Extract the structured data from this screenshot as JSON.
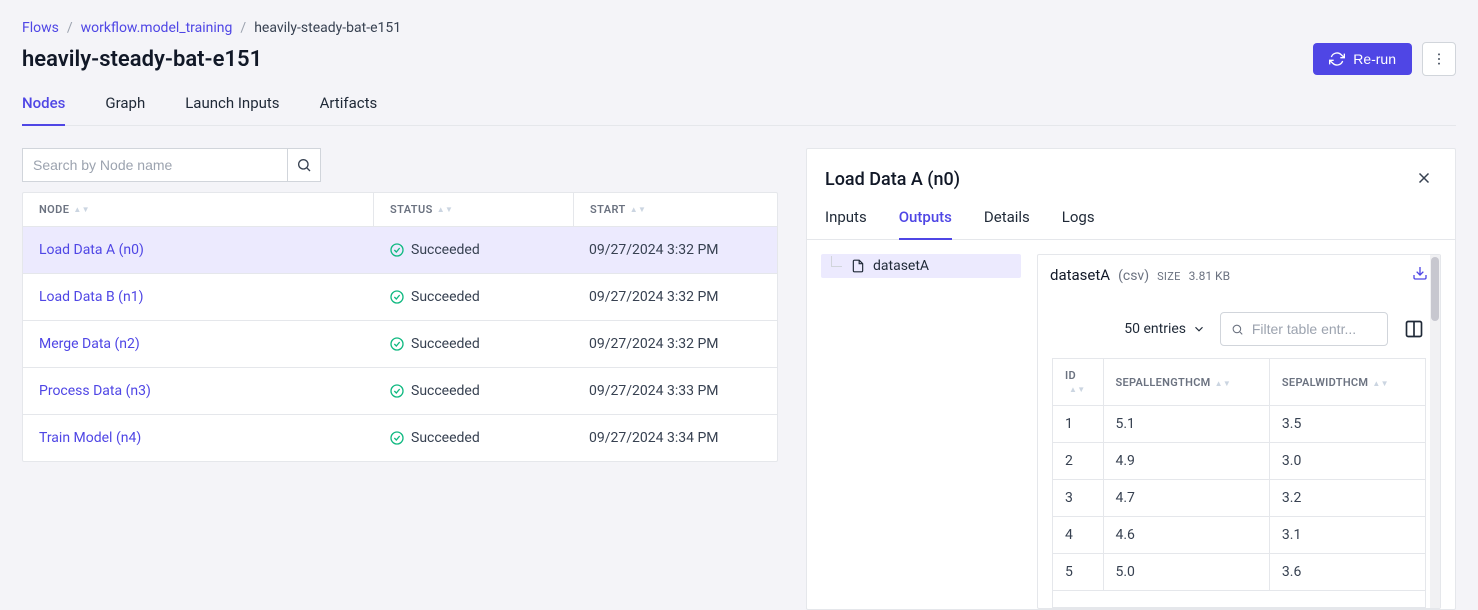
{
  "breadcrumb": {
    "flows": "Flows",
    "workflow": "workflow.model_training",
    "current": "heavily-steady-bat-e151"
  },
  "page_title": "heavily-steady-bat-e151",
  "header": {
    "rerun_label": "Re-run"
  },
  "tabs": [
    "Nodes",
    "Graph",
    "Launch Inputs",
    "Artifacts"
  ],
  "active_tab": 0,
  "search": {
    "placeholder": "Search by Node name"
  },
  "nodes_table": {
    "columns": [
      "NODE",
      "STATUS",
      "START"
    ],
    "rows": [
      {
        "name": "Load Data A (n0)",
        "status": "Succeeded",
        "start": "09/27/2024 3:32 PM",
        "selected": true
      },
      {
        "name": "Load Data B (n1)",
        "status": "Succeeded",
        "start": "09/27/2024 3:32 PM",
        "selected": false
      },
      {
        "name": "Merge Data (n2)",
        "status": "Succeeded",
        "start": "09/27/2024 3:32 PM",
        "selected": false
      },
      {
        "name": "Process Data (n3)",
        "status": "Succeeded",
        "start": "09/27/2024 3:33 PM",
        "selected": false
      },
      {
        "name": "Train Model (n4)",
        "status": "Succeeded",
        "start": "09/27/2024 3:34 PM",
        "selected": false
      }
    ]
  },
  "panel": {
    "title": "Load Data A (n0)",
    "tabs": [
      "Inputs",
      "Outputs",
      "Details",
      "Logs"
    ],
    "active_tab": 1,
    "tree": {
      "item": "datasetA"
    },
    "output": {
      "name": "datasetA",
      "type": "(csv)",
      "size_label": "SIZE",
      "size": "3.81 KB"
    },
    "data_controls": {
      "entries": "50 entries",
      "filter_placeholder": "Filter table entr..."
    },
    "data_table": {
      "columns": [
        "ID",
        "SEPALLENGTHCM",
        "SEPALWIDTHCM"
      ],
      "rows": [
        {
          "id": "1",
          "sl": "5.1",
          "sw": "3.5"
        },
        {
          "id": "2",
          "sl": "4.9",
          "sw": "3.0"
        },
        {
          "id": "3",
          "sl": "4.7",
          "sw": "3.2"
        },
        {
          "id": "4",
          "sl": "4.6",
          "sw": "3.1"
        },
        {
          "id": "5",
          "sl": "5.0",
          "sw": "3.6"
        }
      ]
    }
  }
}
